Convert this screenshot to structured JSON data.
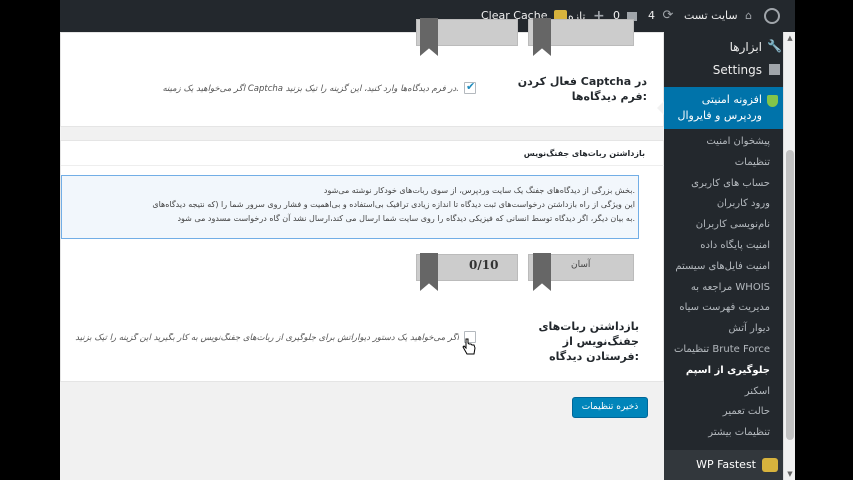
{
  "admin_bar": {
    "site_name": "سایت تست",
    "updates_count": "4",
    "comments_count": "0",
    "new_label": "تازه",
    "clear_cache_label": "Clear Cache"
  },
  "sidebar": {
    "tools_label": "ابزارها",
    "settings_label": "Settings",
    "active_plugin_label": "افزونه امنیتی وردپرس و فایروال",
    "submenu": [
      "پیشخوان امنیت",
      "تنظیمات",
      "حساب های کاربری",
      "ورود کاربران",
      "نام‌نویسی کاربران",
      "امنیت پایگاه داده",
      "امنیت فایل‌های سیستم",
      "مراجعه به WHOIS",
      "مدیریت فهرست سیاه",
      "دیوار آتش",
      "تنظیمات Brute Force",
      "جلوگیری از اسپم",
      "اسکنر",
      "حالت تعمیر",
      "تنظیمات بیشتر"
    ],
    "current_index": 11,
    "cache_plugin_label": "WP Fastest Cache"
  },
  "captcha_section": {
    "label": "فعال کردن Captcha در فرم دیدگاه‌ها:",
    "description": "اگر می‌خواهید یک زمینه Captcha در فرم دیدگاه‌ها وارد کنید، این گزینه را تیک بزنید.",
    "checked": true
  },
  "spambot_section": {
    "header": "بازداشتن ربات‌های جفنگ‌نویس",
    "info_lines": [
      "بخش بزرگی از دیدگاه‌های جفنگ یک سایت وردپرس، از سوی ربات‌های خودکار نوشته می‌شود.",
      "این ویژگی از راه بازداشتن درخواست‌های ثبت دیدگاه تا اندازه زیادی ترافیک بی‌استفاده و بی‌اهمیت و فشار روی سرور شما را (که نتیجه دیدگاه‌های",
      "به بیان دیگر، اگر دیدگاه توسط انسانی که فیزیکی دیدگاه را روی سایت شما ارسال می کند،ارسال نشد آن گاه درخواست مسدود می شود."
    ],
    "difficulty_label": "آسان",
    "score_label": "0/10",
    "label": "بازداشتن ربات‌های جفنگ‌نویس از فرستادن دیدگاه:",
    "description": "اگر می‌خواهید یک دستور دیوارآتش برای جلوگیری از ربات‌های جفنگ‌نویس به کار بگیرید این گزینه را تیک بزنید",
    "checked": false
  },
  "save_button_label": "ذخیره تنظیمات",
  "colors": {
    "admin_bar": "#23282d",
    "active_menu": "#0073aa",
    "primary_button": "#0085ba"
  }
}
